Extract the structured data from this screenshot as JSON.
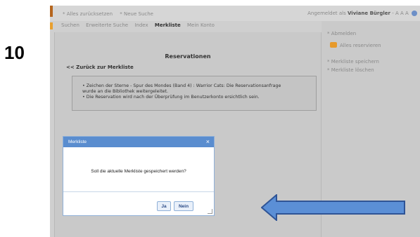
{
  "step_number": "10",
  "topbar": {
    "reset_label": "* Alles zurücksetzen",
    "new_search_label": "* Neue Suche",
    "logged_in_prefix": "Angemeldet als",
    "user_name": "Viviane Bürgler",
    "font_size_label": "- A A A"
  },
  "tabs": [
    {
      "label": "Suchen"
    },
    {
      "label": "Erweiterte Suche"
    },
    {
      "label": "Index"
    },
    {
      "label": "Merkliste"
    },
    {
      "label": "Mein Konto"
    }
  ],
  "main": {
    "title": "Reservationen",
    "back_link": "<< Zurück zur Merkliste",
    "messages": [
      "• Zeichen der Sterne - Spur des Mondes (Band 4) : Warrior Cats: Die Reservationsanfrage",
      "   wurde an die Bibliothek weitergeleitet.",
      "• Die Reservation wird nach der Überprüfung im Benutzerkonto ersichtlich sein."
    ]
  },
  "sidebar": {
    "logout_label": "* Abmelden",
    "reserve_all_label": "Alles reservieren",
    "save_list_label": "* Merkliste speichern",
    "delete_list_label": "* Merkliste löschen"
  },
  "dialog": {
    "title": "Merkliste",
    "close_label": "×",
    "message": "Soll die aktuelle Merkliste gespeichert werden?",
    "yes_label": "Ja",
    "no_label": "Nein"
  },
  "colors": {
    "dialog_header": "#5a8dcf",
    "arrow_fill": "#5b8fd6",
    "arrow_stroke": "#2f5496",
    "badge": "#e79a2b"
  }
}
